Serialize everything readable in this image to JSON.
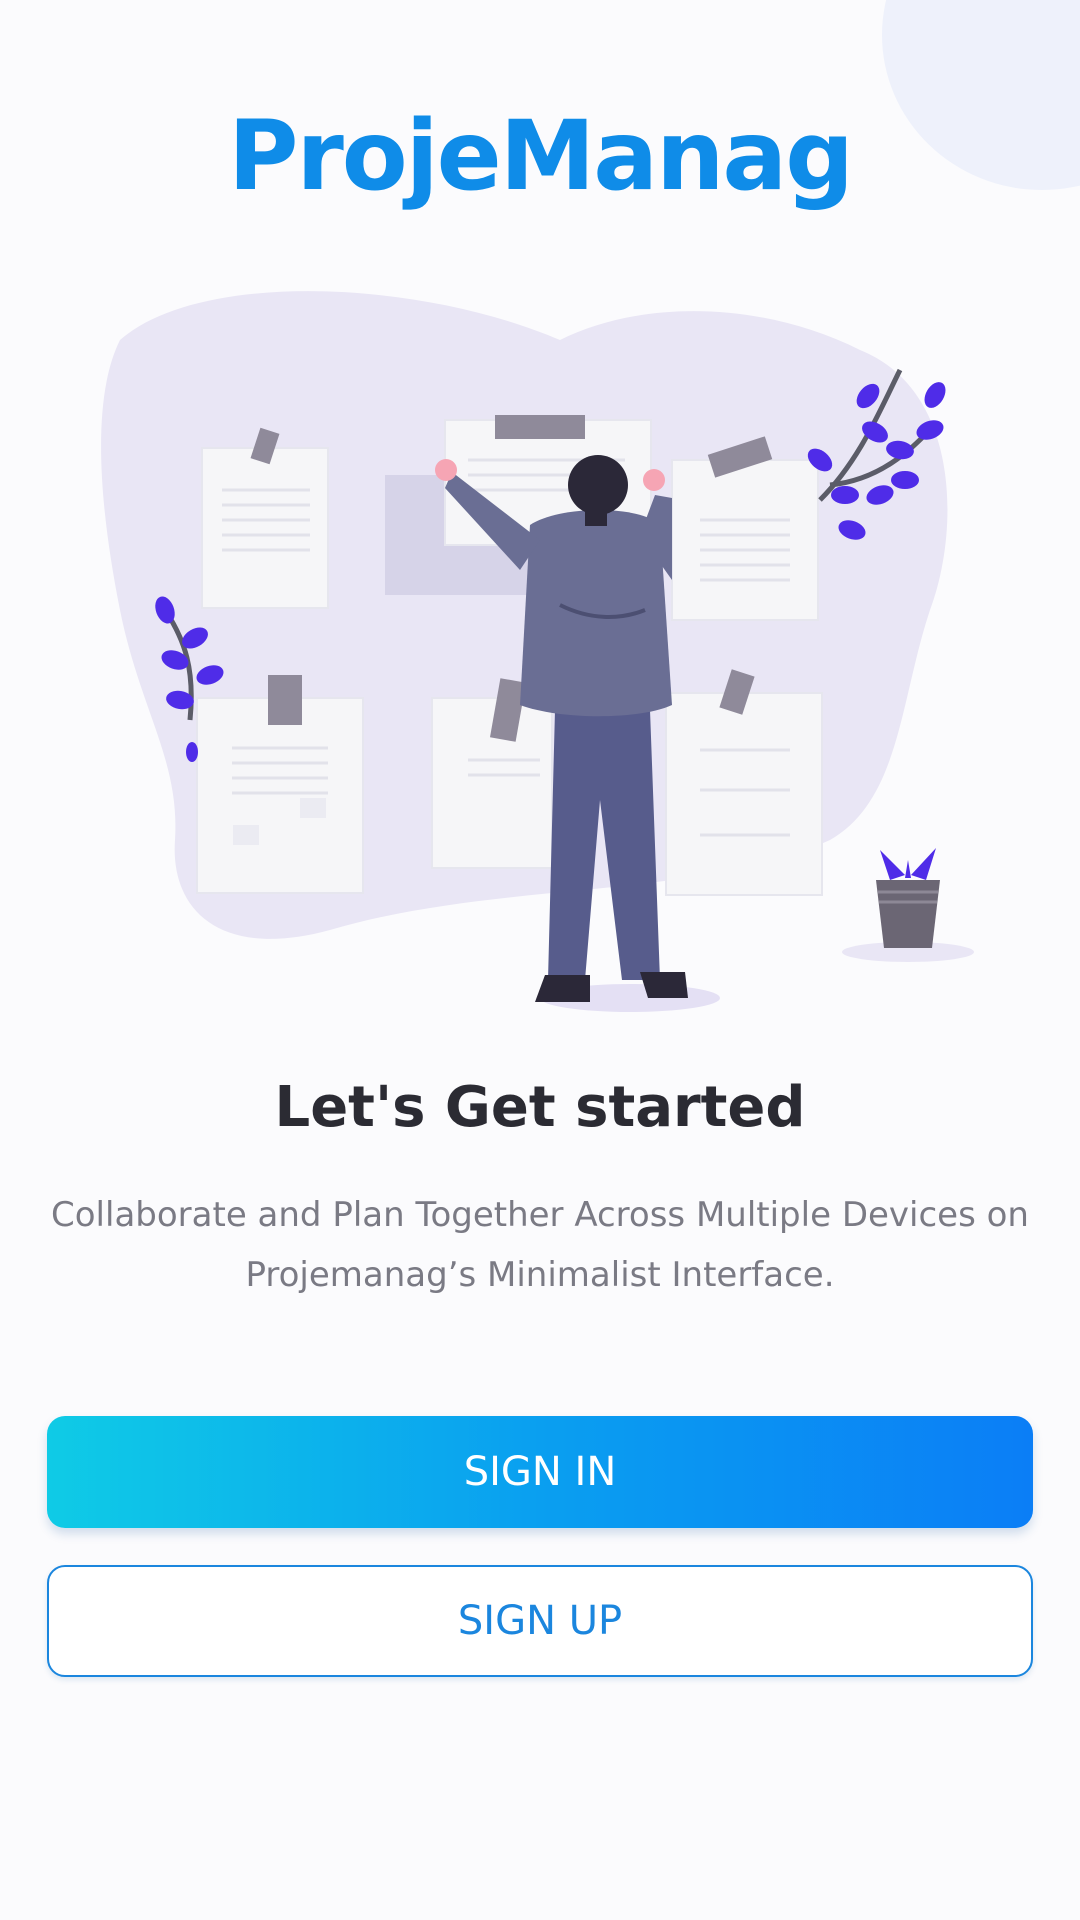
{
  "app": {
    "logo_text": "ProjeManag"
  },
  "intro": {
    "headline": "Let's Get started",
    "subtitle": "Collaborate and Plan Together Across Multiple Devices on Projemanag’s Minimalist Interface."
  },
  "actions": {
    "sign_in_label": "SIGN IN",
    "sign_up_label": "SIGN UP"
  },
  "colors": {
    "brand": "#0f8ce8",
    "button_gradient_start": "#0fcbe6",
    "button_gradient_end": "#0b7ef6",
    "outline": "#1b86de",
    "accent_plant": "#4f2ce8"
  },
  "illustration": {
    "icon": "person-pinning-notes-illustration"
  }
}
